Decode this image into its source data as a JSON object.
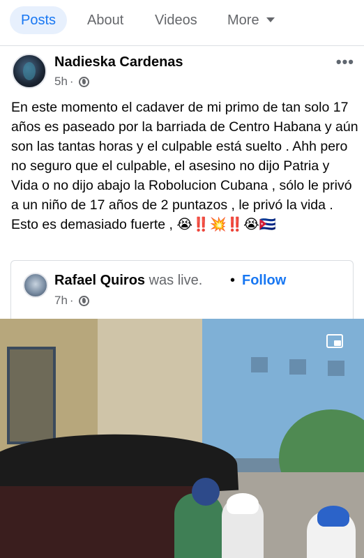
{
  "tabs": {
    "posts": "Posts",
    "about": "About",
    "videos": "Videos",
    "more": "More"
  },
  "post": {
    "author": "Nadieska Cardenas",
    "time": "5h",
    "separator": "·",
    "text": "En este momento el cadaver de mi primo de tan solo 17 años es paseado por la barriada de Centro Habana y aún son las tantas horas y el culpable está suelto . Ahh pero no seguro que el culpable, el asesino no dijo Patria y Vida o no dijo abajo la Robolucion Cubana , sólo le privó a un niño de 17 años de 2 puntazos , le privó la vida . Esto es demasiado fuerte ,",
    "emojis": "😭‼️💥‼️😭🇨🇺",
    "more_icon": "•••"
  },
  "shared": {
    "author": "Rafael Quiros",
    "action": "was live.",
    "bullet": "•",
    "follow": "Follow",
    "time": "7h",
    "separator": "·"
  },
  "icons": {
    "privacy": "globe-icon",
    "options": "more-dots-icon",
    "pip": "picture-in-picture-icon",
    "more_tab": "caret-down-icon"
  },
  "colors": {
    "accent": "#1877f2",
    "active_tab_bg": "#e7f0fd",
    "secondary_text": "#65676b"
  }
}
